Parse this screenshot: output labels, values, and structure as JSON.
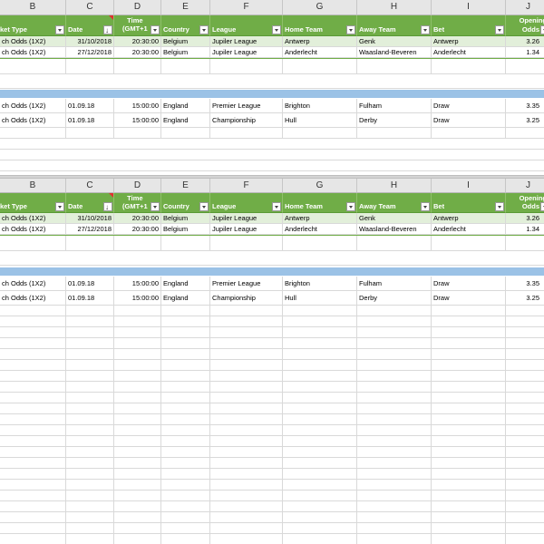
{
  "columns": [
    "B",
    "C",
    "D",
    "E",
    "F",
    "G",
    "H",
    "I",
    "J"
  ],
  "header": {
    "market_type": "ket Type",
    "date": "Date",
    "time_line1": "Time",
    "time_line2": "(GMT+1",
    "country": "Country",
    "league": "League",
    "home_team": "Home Team",
    "away_team": "Away Team",
    "bet": "Bet",
    "odds_line1": "Opening",
    "odds_line2": "Odds"
  },
  "table1": [
    {
      "market": "ch Odds (1X2)",
      "date": "31/10/2018",
      "time": "20:30:00",
      "country": "Belgium",
      "league": "Jupiler League",
      "home": "Antwerp",
      "away": "Genk",
      "bet": "Antwerp",
      "odds": "3.26"
    },
    {
      "market": "ch Odds (1X2)",
      "date": "27/12/2018",
      "time": "20:30:00",
      "country": "Belgium",
      "league": "Jupiler League",
      "home": "Anderlecht",
      "away": "Waasland-Beveren",
      "bet": "Anderlecht",
      "odds": "1.34"
    }
  ],
  "table2": [
    {
      "market": "ch Odds (1X2)",
      "date": "01.09.18",
      "time": "15:00:00",
      "country": "England",
      "league": "Premier League",
      "home": "Brighton",
      "away": "Fulham",
      "bet": "Draw",
      "odds": "3.35"
    },
    {
      "market": "ch Odds (1X2)",
      "date": "01.09.18",
      "time": "15:00:00",
      "country": "England",
      "league": "Championship",
      "home": "Hull",
      "away": "Derby",
      "bet": "Draw",
      "odds": "3.25"
    }
  ]
}
